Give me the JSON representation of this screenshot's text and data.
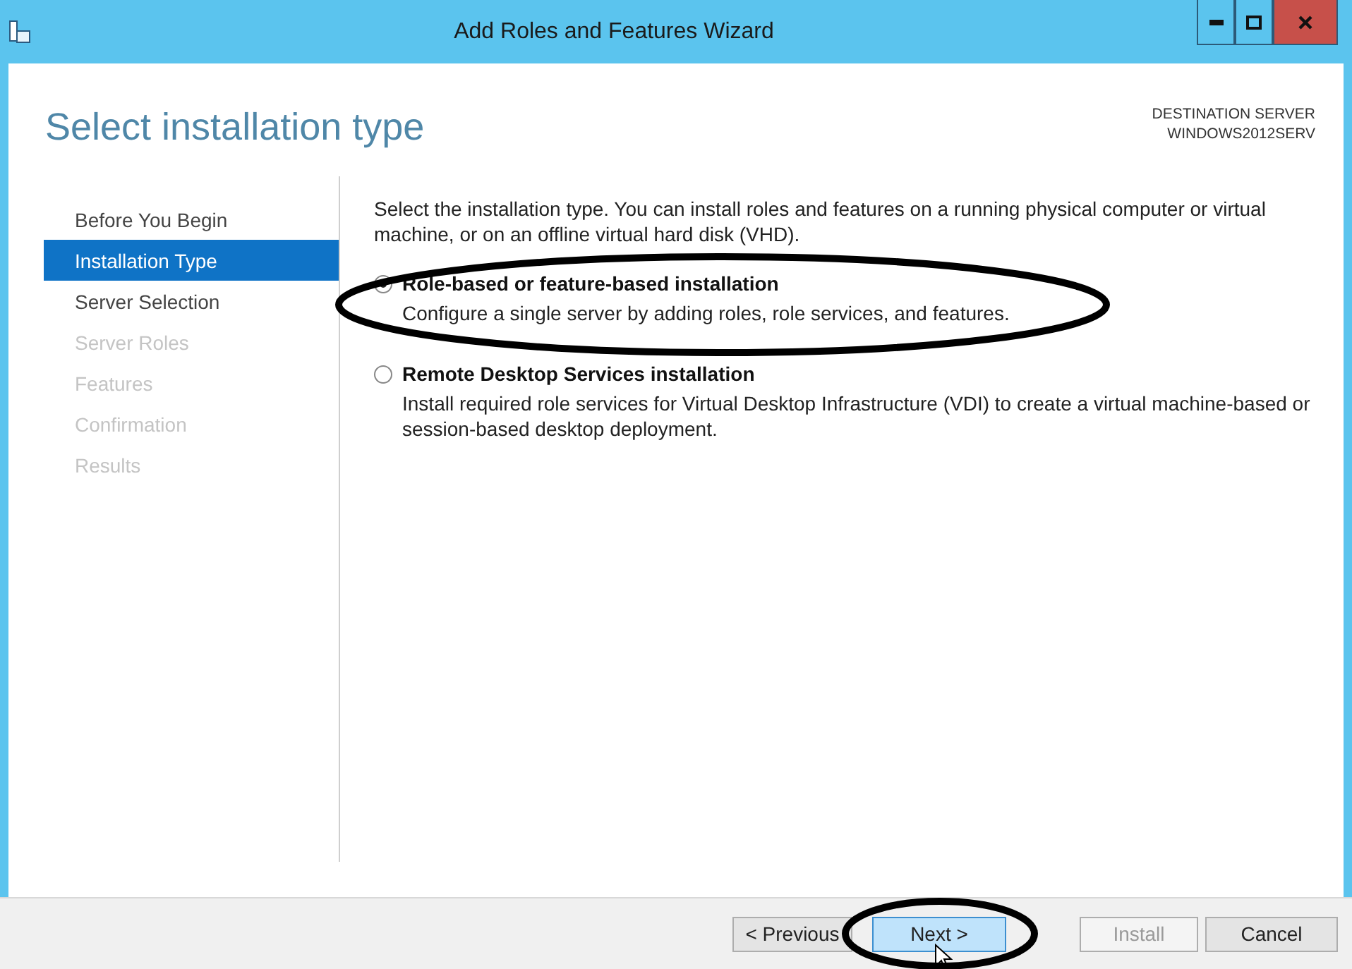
{
  "window": {
    "title": "Add Roles and Features Wizard"
  },
  "page_title": "Select installation type",
  "destination": {
    "label": "DESTINATION SERVER",
    "server": "WINDOWS2012SERV"
  },
  "sidebar": {
    "items": [
      {
        "label": "Before You Begin",
        "selected": false,
        "disabled": false
      },
      {
        "label": "Installation Type",
        "selected": true,
        "disabled": false
      },
      {
        "label": "Server Selection",
        "selected": false,
        "disabled": false
      },
      {
        "label": "Server Roles",
        "selected": false,
        "disabled": true
      },
      {
        "label": "Features",
        "selected": false,
        "disabled": true
      },
      {
        "label": "Confirmation",
        "selected": false,
        "disabled": true
      },
      {
        "label": "Results",
        "selected": false,
        "disabled": true
      }
    ]
  },
  "intro": "Select the installation type. You can install roles and features on a running physical computer or virtual machine, or on an offline virtual hard disk (VHD).",
  "options": [
    {
      "label": "Role-based or feature-based installation",
      "description": "Configure a single server by adding roles, role services, and features.",
      "selected": true,
      "circled": true
    },
    {
      "label": "Remote Desktop Services installation",
      "description": "Install required role services for Virtual Desktop Infrastructure (VDI) to create a virtual machine-based or session-based desktop deployment.",
      "selected": false,
      "circled": false
    }
  ],
  "buttons": [
    {
      "label": "< Previous",
      "disabled": false,
      "highlighted": false,
      "circled": false
    },
    {
      "label": "Next >",
      "disabled": false,
      "highlighted": true,
      "circled": true
    },
    {
      "label": "Install",
      "disabled": true,
      "highlighted": false,
      "circled": false
    },
    {
      "label": "Cancel",
      "disabled": false,
      "highlighted": false,
      "circled": false
    }
  ]
}
